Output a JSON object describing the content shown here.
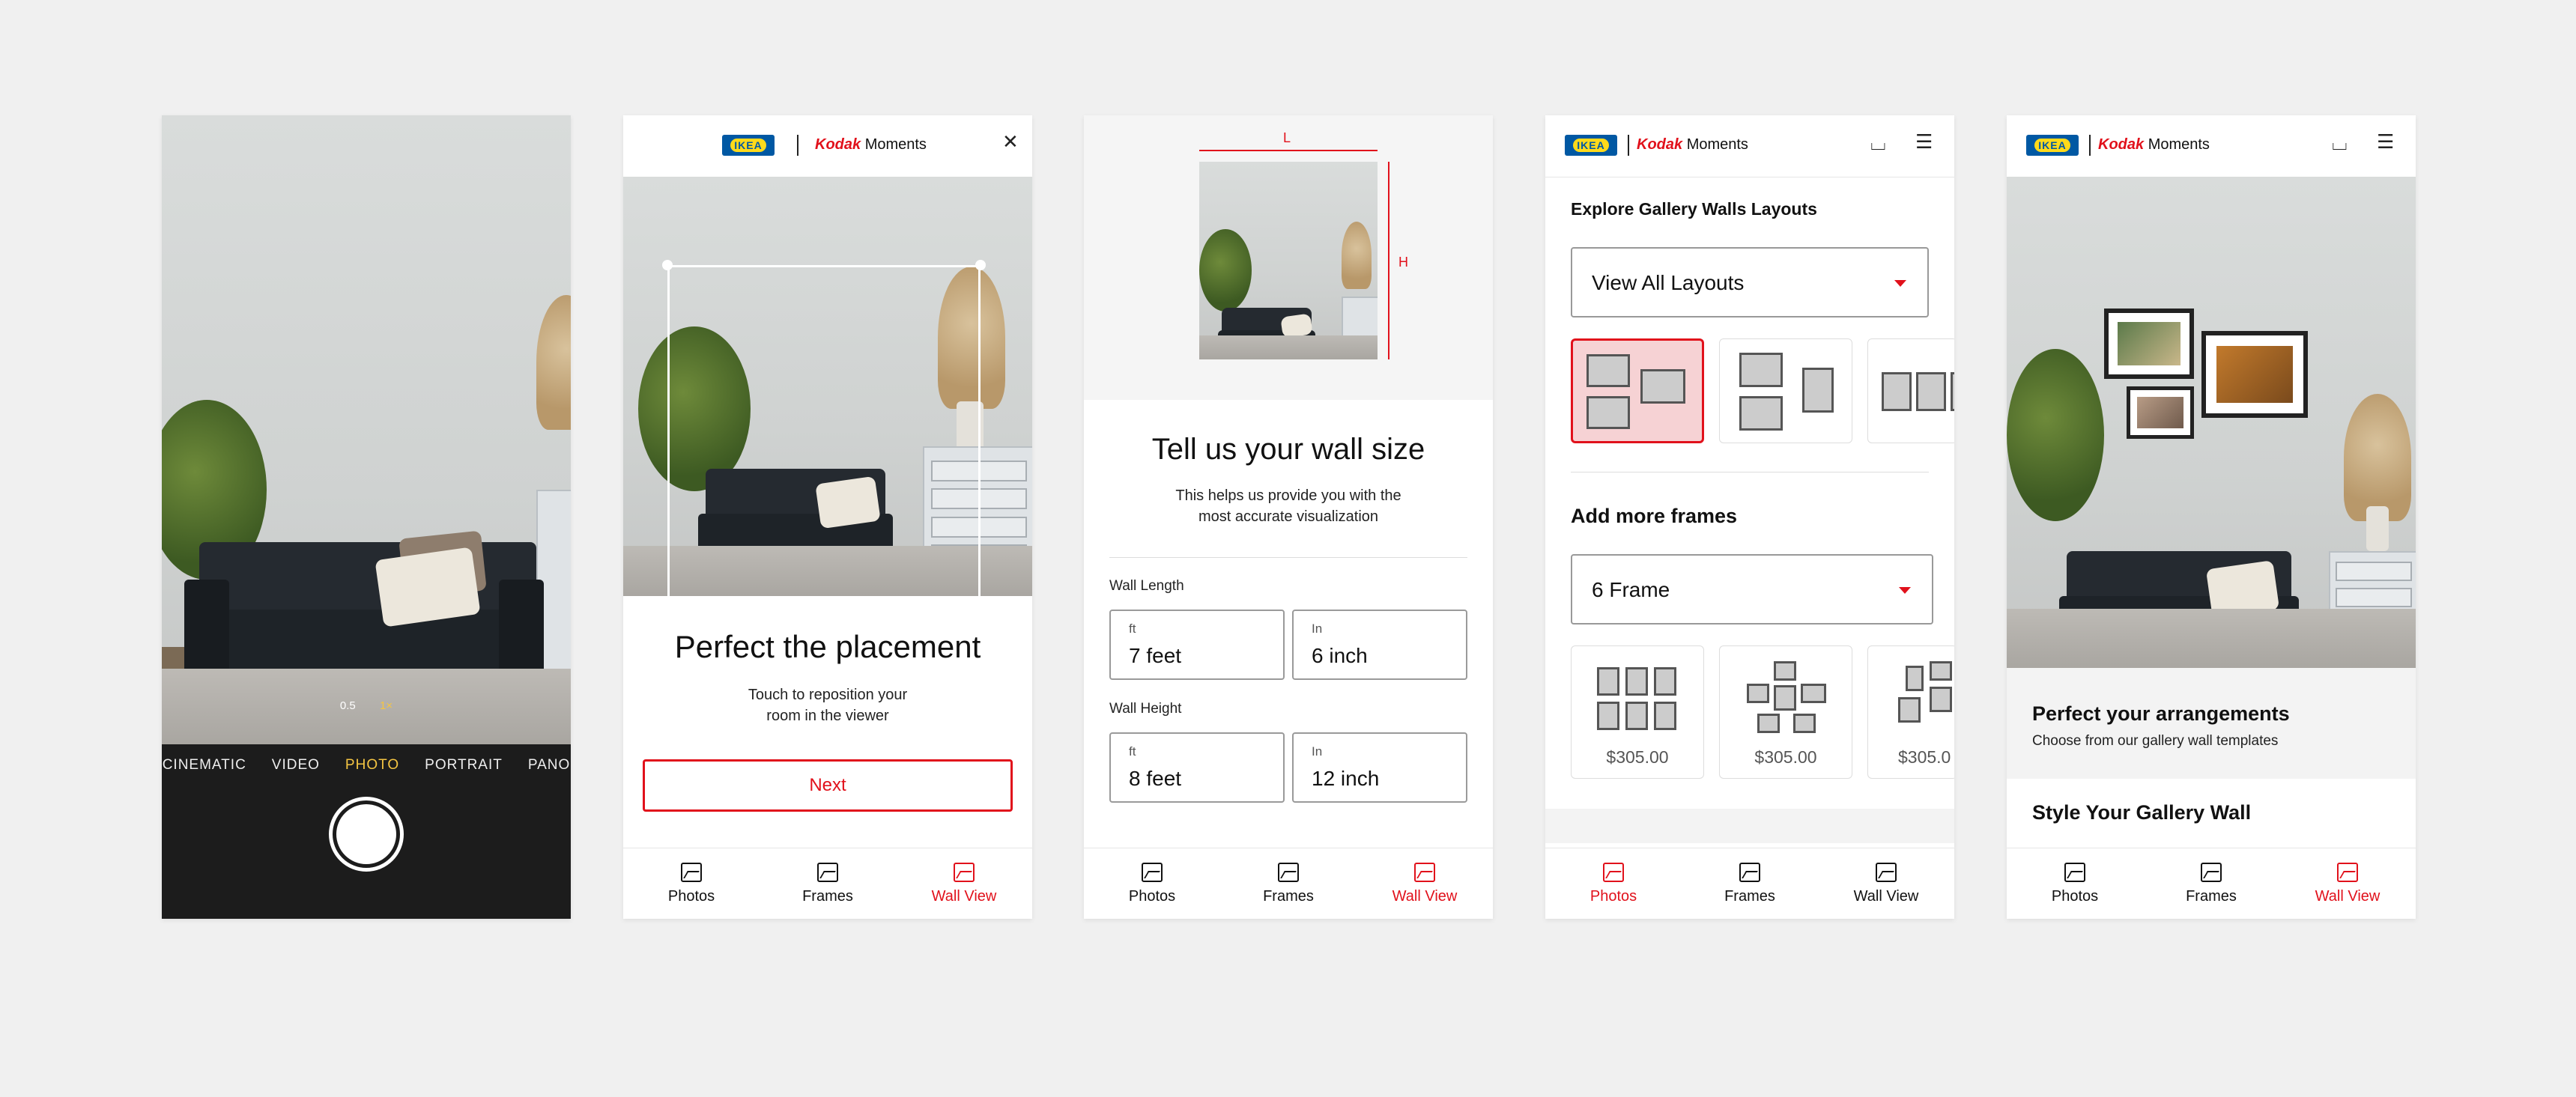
{
  "camera": {
    "zoom": [
      "0.5",
      "1×"
    ],
    "modes": [
      "CINEMATIC",
      "VIDEO",
      "PHOTO",
      "PORTRAIT",
      "PANO"
    ],
    "active_mode": "PHOTO"
  },
  "brand": {
    "ikea": "IKEA",
    "kodak": "Kodak",
    "moments": "Moments"
  },
  "placement": {
    "title": "Perfect the placement",
    "subtitle_line1": "Touch to reposition your",
    "subtitle_line2": "room in the viewer",
    "next": "Next"
  },
  "wall_size": {
    "dim_length": "L",
    "dim_height": "H",
    "title": "Tell us your wall size",
    "subtitle_line1": "This helps us provide you with the",
    "subtitle_line2": "most accurate visualization",
    "length_label": "Wall Length",
    "height_label": "Wall Height",
    "length_ft_unit": "ft",
    "length_ft": "7 feet",
    "length_in_unit": "In",
    "length_in": "6 inch",
    "height_ft_unit": "ft",
    "height_ft": "8 feet",
    "height_in_unit": "In",
    "height_in": "12 inch"
  },
  "layouts": {
    "title": "Explore Gallery Walls Layouts",
    "select_value": "View All Layouts",
    "add_title": "Add more frames",
    "frame_select": "6 Frame",
    "prices": [
      "$305.00",
      "$305.00",
      "$305.0"
    ]
  },
  "arrangements": {
    "title": "Perfect your arrangements",
    "subtitle": "Choose from our gallery wall templates",
    "style_title": "Style Your Gallery Wall"
  },
  "nav": {
    "photos": "Photos",
    "frames": "Frames",
    "wall_view": "Wall View"
  },
  "colors": {
    "accent": "#e1111b",
    "ikea_blue": "#0058a3",
    "ikea_yellow": "#ffda1a"
  }
}
